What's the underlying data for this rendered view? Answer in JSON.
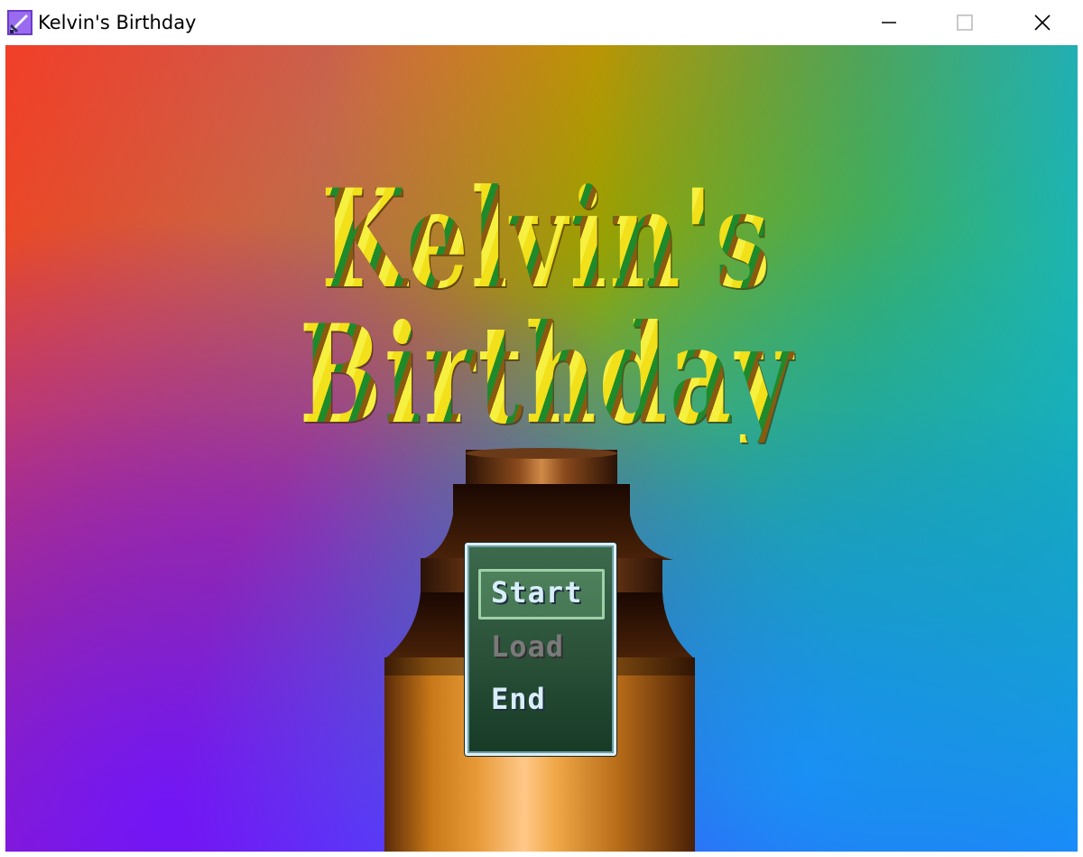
{
  "window": {
    "title": "Kelvin's Birthday",
    "controls": {
      "minimize": "minimize-icon",
      "maximize": "maximize-icon",
      "close": "close-icon"
    }
  },
  "game": {
    "title": "Kelvin's Birthday",
    "menu": {
      "items": [
        {
          "label": "Start",
          "state": "selected"
        },
        {
          "label": "Load",
          "state": "disabled"
        },
        {
          "label": "End",
          "state": "enabled"
        }
      ]
    }
  }
}
